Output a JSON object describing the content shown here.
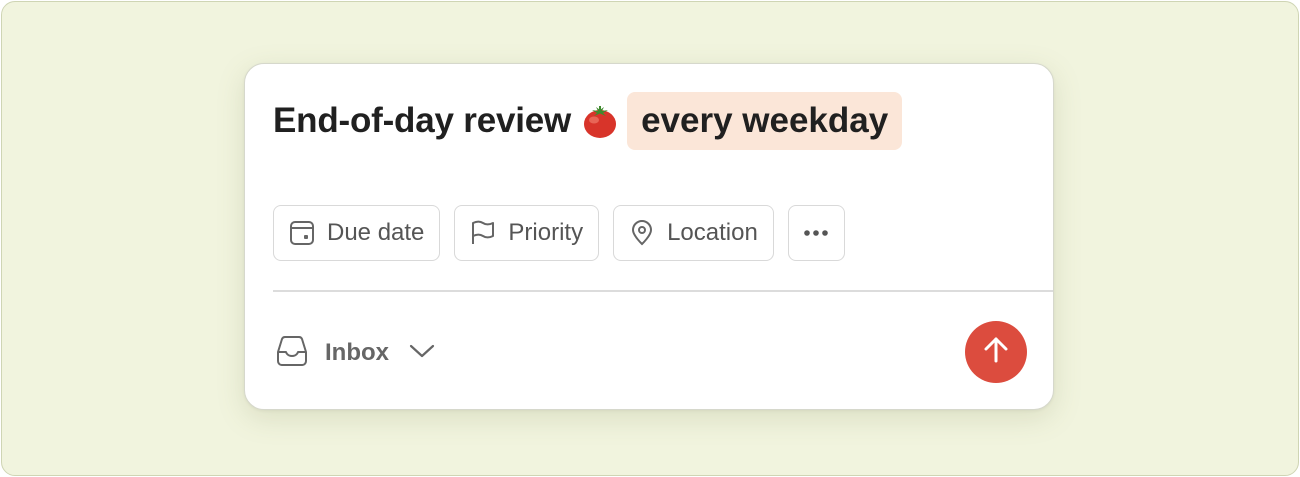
{
  "task": {
    "title": "End-of-day review",
    "emoji_icon": "tomato-icon",
    "recurrence": "every weekday"
  },
  "chips": [
    {
      "label": "Due date",
      "icon": "calendar-icon"
    },
    {
      "label": "Priority",
      "icon": "flag-icon"
    },
    {
      "label": "Location",
      "icon": "location-pin-icon"
    },
    {
      "label": "",
      "icon": "more-horizontal-icon"
    }
  ],
  "footer": {
    "project": "Inbox",
    "project_icon": "inbox-icon"
  },
  "colors": {
    "backdrop": "#f1f4de",
    "recurrence_highlight": "#fbe6d8",
    "accent": "#dc4c3e",
    "text": "#202020",
    "muted": "#555555"
  }
}
